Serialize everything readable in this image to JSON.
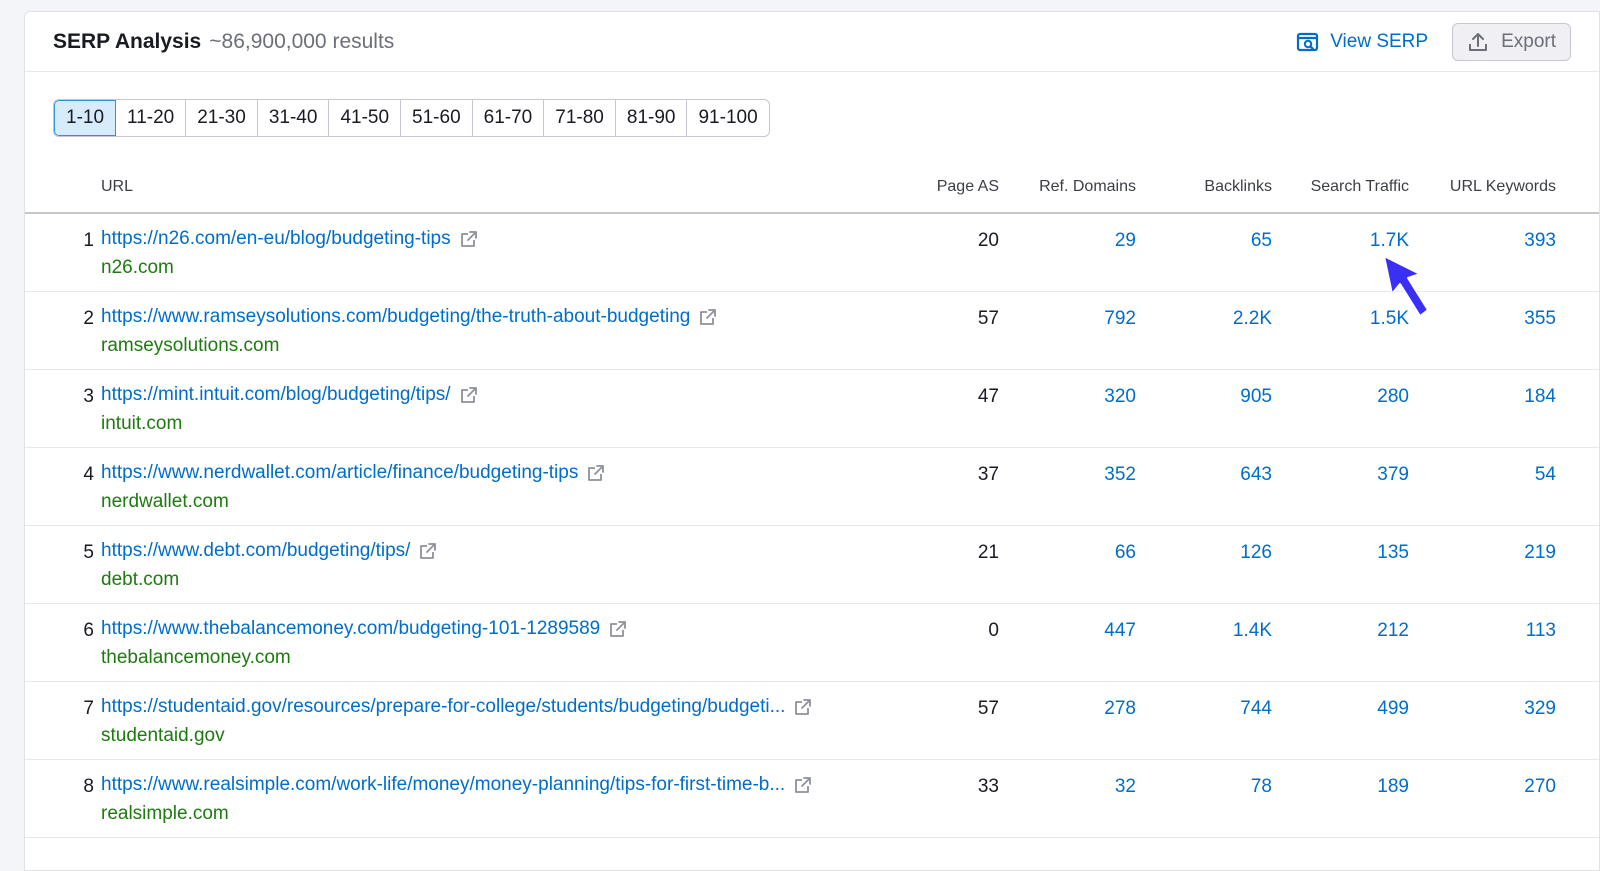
{
  "header": {
    "title": "SERP Analysis",
    "results": "~86,900,000 results",
    "view_serp": "View SERP",
    "export": "Export"
  },
  "pagination": [
    "1-10",
    "11-20",
    "21-30",
    "31-40",
    "41-50",
    "51-60",
    "61-70",
    "71-80",
    "81-90",
    "91-100"
  ],
  "active_page": "1-10",
  "columns": {
    "url": "URL",
    "page_as": "Page AS",
    "ref_domains": "Ref. Domains",
    "backlinks": "Backlinks",
    "search_traffic": "Search Traffic",
    "url_keywords": "URL Keywords"
  },
  "rows": [
    {
      "num": "1",
      "url": "https://n26.com/en-eu/blog/budgeting-tips",
      "domain": "n26.com",
      "page_as": "20",
      "ref_domains": "29",
      "backlinks": "65",
      "search_traffic": "1.7K",
      "url_keywords": "393"
    },
    {
      "num": "2",
      "url": "https://www.ramseysolutions.com/budgeting/the-truth-about-budgeting",
      "domain": "ramseysolutions.com",
      "page_as": "57",
      "ref_domains": "792",
      "backlinks": "2.2K",
      "search_traffic": "1.5K",
      "url_keywords": "355"
    },
    {
      "num": "3",
      "url": "https://mint.intuit.com/blog/budgeting/tips/",
      "domain": "intuit.com",
      "page_as": "47",
      "ref_domains": "320",
      "backlinks": "905",
      "search_traffic": "280",
      "url_keywords": "184"
    },
    {
      "num": "4",
      "url": "https://www.nerdwallet.com/article/finance/budgeting-tips",
      "domain": "nerdwallet.com",
      "page_as": "37",
      "ref_domains": "352",
      "backlinks": "643",
      "search_traffic": "379",
      "url_keywords": "54"
    },
    {
      "num": "5",
      "url": "https://www.debt.com/budgeting/tips/",
      "domain": "debt.com",
      "page_as": "21",
      "ref_domains": "66",
      "backlinks": "126",
      "search_traffic": "135",
      "url_keywords": "219"
    },
    {
      "num": "6",
      "url": "https://www.thebalancemoney.com/budgeting-101-1289589",
      "domain": "thebalancemoney.com",
      "page_as": "0",
      "ref_domains": "447",
      "backlinks": "1.4K",
      "search_traffic": "212",
      "url_keywords": "113"
    },
    {
      "num": "7",
      "url": "https://studentaid.gov/resources/prepare-for-college/students/budgeting/budgeti...",
      "domain": "studentaid.gov",
      "page_as": "57",
      "ref_domains": "278",
      "backlinks": "744",
      "search_traffic": "499",
      "url_keywords": "329"
    },
    {
      "num": "8",
      "url": "https://www.realsimple.com/work-life/money/money-planning/tips-for-first-time-b...",
      "domain": "realsimple.com",
      "page_as": "33",
      "ref_domains": "32",
      "backlinks": "78",
      "search_traffic": "189",
      "url_keywords": "270"
    }
  ],
  "icons": {
    "view_serp": "serp-preview-icon",
    "export": "upload-icon",
    "external": "external-link-icon",
    "pointer": "arrow-pointer-icon"
  },
  "colors": {
    "link": "#006dca",
    "domain": "#1e7a10",
    "active_page_bg": "#d7ebfc",
    "pointer": "#3a2ff5"
  }
}
